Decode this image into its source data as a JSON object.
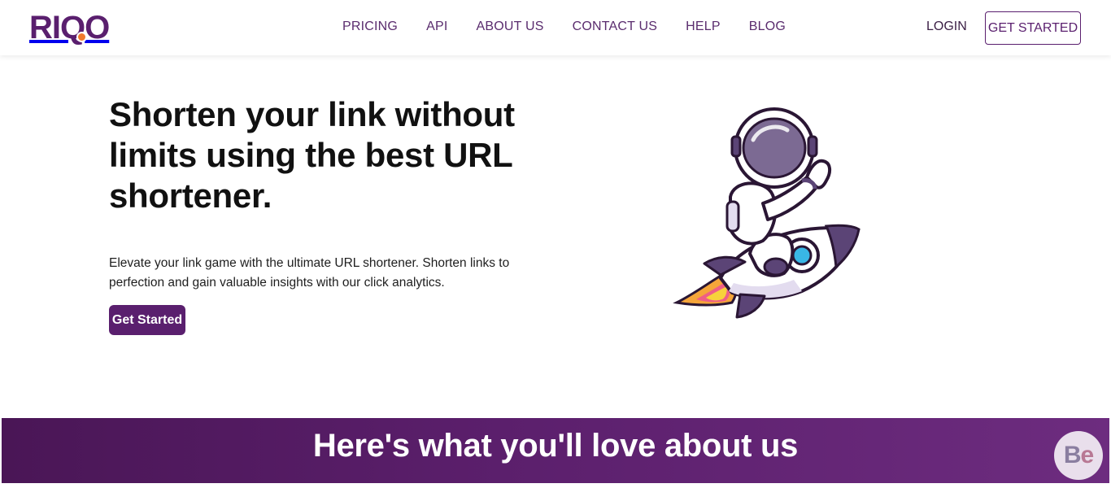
{
  "brand": {
    "logo_text_start": "RI",
    "logo_text_q": "Q",
    "logo_text_end": "O",
    "primary_color": "#5a1f6e",
    "accent_color": "#f07a2c"
  },
  "nav": {
    "items": [
      "PRICING",
      "API",
      "ABOUT US",
      "CONTACT US",
      "HELP",
      "BLOG"
    ],
    "login_label": "LOGIN",
    "get_started_label": "GET STARTED"
  },
  "hero": {
    "title": "Shorten your link without limits using the best URL shortener.",
    "subtitle": "Elevate your link game with the ultimate URL shortener. Shorten links to perfection and gain valuable insights with our click analytics.",
    "cta_label": "Get Started",
    "illustration_icon": "astronaut-rocket-icon"
  },
  "banner": {
    "title": "Here's what you'll love about us"
  },
  "badge": {
    "text_b": "B",
    "text_e": "e",
    "icon": "behance-badge-icon"
  }
}
